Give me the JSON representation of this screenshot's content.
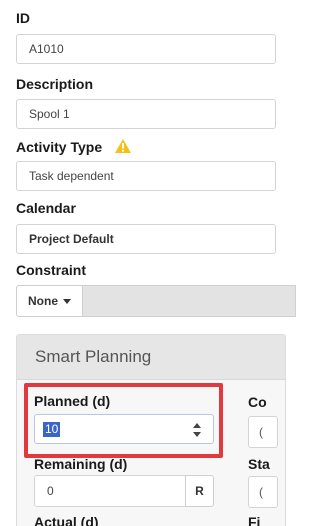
{
  "fields": {
    "id": {
      "label": "ID",
      "value": "A1010"
    },
    "description": {
      "label": "Description",
      "value": "Spool 1"
    },
    "activity_type": {
      "label": "Activity Type",
      "value": "Task dependent"
    },
    "calendar": {
      "label": "Calendar",
      "value": "Project Default"
    },
    "constraint": {
      "label": "Constraint",
      "value": "None"
    }
  },
  "smart_planning": {
    "title": "Smart Planning",
    "planned": {
      "label": "Planned (d)",
      "value": "10"
    },
    "remaining": {
      "label": "Remaining (d)",
      "value": "0",
      "button": "R"
    },
    "actual": {
      "label": "Actual (d)"
    },
    "right_col": {
      "label1": "Co",
      "value1": "(",
      "label2": "Sta",
      "value2": "(",
      "label3": "Fi"
    }
  },
  "colors": {
    "highlight": "#e0393e",
    "warning": "#f2c21b",
    "selection": "#3b64c8"
  },
  "icons": {
    "warning": "warning-triangle-icon",
    "caret": "caret-down-icon",
    "spinner": "spinner-arrows-icon"
  }
}
